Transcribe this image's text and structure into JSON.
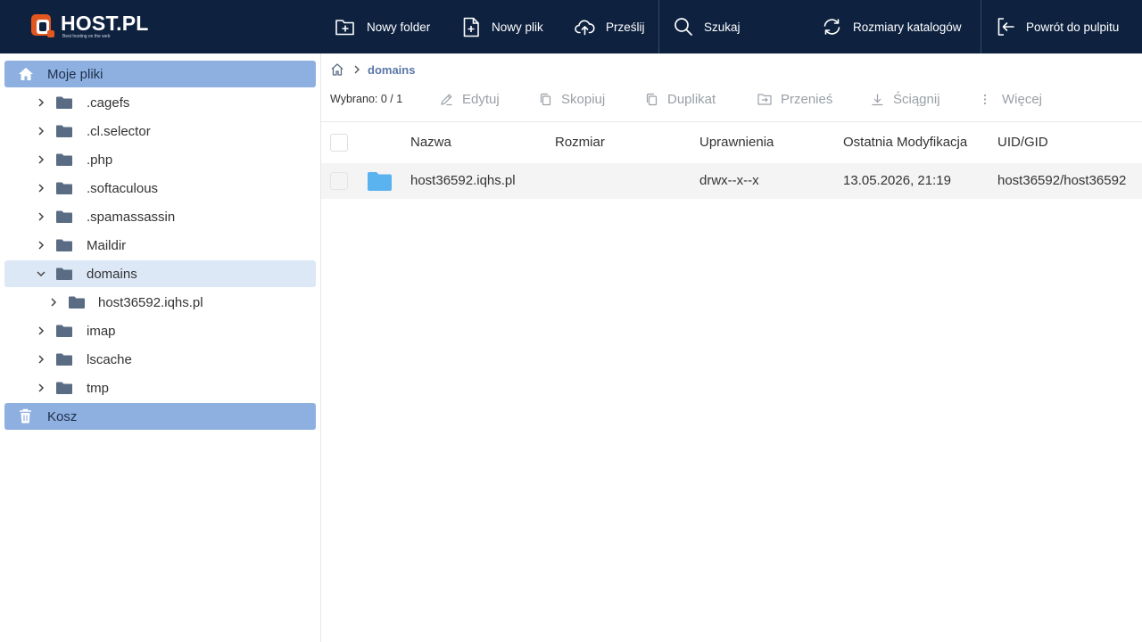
{
  "app": {
    "logo_name": "HOST.PL",
    "logo_tagline": "Best hosting on the web",
    "brand_color": "#0e2240",
    "accent_color": "#e2571f"
  },
  "toolbar": {
    "new_folder": "Nowy folder",
    "new_file": "Nowy plik",
    "upload": "Prześlij",
    "search": "Szukaj",
    "dir_sizes": "Rozmiary katalogów",
    "back_to_panel": "Powrót do pulpitu"
  },
  "sidebar": {
    "root_label": "Moje pliki",
    "items": [
      {
        "label": ".cagefs",
        "expanded": false
      },
      {
        "label": ".cl.selector",
        "expanded": false
      },
      {
        "label": ".php",
        "expanded": false
      },
      {
        "label": ".softaculous",
        "expanded": false
      },
      {
        "label": ".spamassassin",
        "expanded": false
      },
      {
        "label": "Maildir",
        "expanded": false
      },
      {
        "label": "domains",
        "expanded": true,
        "selected": true,
        "children": [
          {
            "label": "host36592.iqhs.pl"
          }
        ]
      },
      {
        "label": "imap",
        "expanded": false
      },
      {
        "label": "lscache",
        "expanded": false
      },
      {
        "label": "tmp",
        "expanded": false
      }
    ],
    "trash_label": "Kosz"
  },
  "breadcrumb": {
    "current": "domains"
  },
  "actions": {
    "selected_count": "Wybrano: 0 / 1",
    "edit": "Edytuj",
    "copy": "Skopiuj",
    "duplicate": "Duplikat",
    "move": "Przenieś",
    "download": "Ściągnij",
    "more": "Więcej"
  },
  "table": {
    "columns": [
      "Nazwa",
      "Rozmiar",
      "Uprawnienia",
      "Ostatnia Modyfikacja",
      "UID/GID"
    ],
    "rows": [
      {
        "name": "host36592.iqhs.pl",
        "size": "",
        "permissions": "drwx--x--x",
        "modified": "13.05.2026, 21:19",
        "uid_gid": "host36592/host36592"
      }
    ]
  }
}
